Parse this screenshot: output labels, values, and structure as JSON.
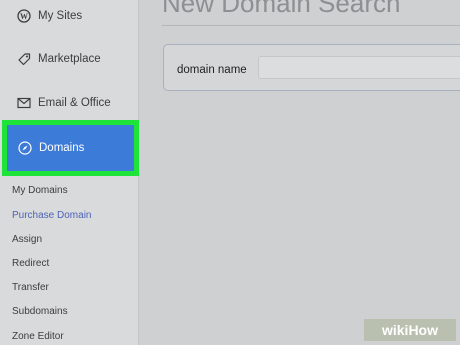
{
  "sidebar": {
    "items": [
      {
        "label": "My Sites",
        "icon": "wordpress-icon"
      },
      {
        "label": "Marketplace",
        "icon": "tag-icon"
      },
      {
        "label": "Email & Office",
        "icon": "envelope-icon"
      }
    ],
    "active": {
      "label": "Domains",
      "icon": "compass-icon"
    },
    "subitems": [
      {
        "label": "My Domains"
      },
      {
        "label": "Purchase Domain"
      },
      {
        "label": "Assign"
      },
      {
        "label": "Redirect"
      },
      {
        "label": "Transfer"
      },
      {
        "label": "Subdomains"
      },
      {
        "label": "Zone Editor"
      }
    ]
  },
  "main": {
    "title": "New Domain Search",
    "search": {
      "label": "domain name",
      "value": "",
      "placeholder": ""
    }
  },
  "watermark": {
    "text": "wikiHow"
  },
  "colors": {
    "active_bg": "#3d7bd8",
    "highlight_border": "#1ee43a",
    "active_subitem": "#4c63b8"
  }
}
